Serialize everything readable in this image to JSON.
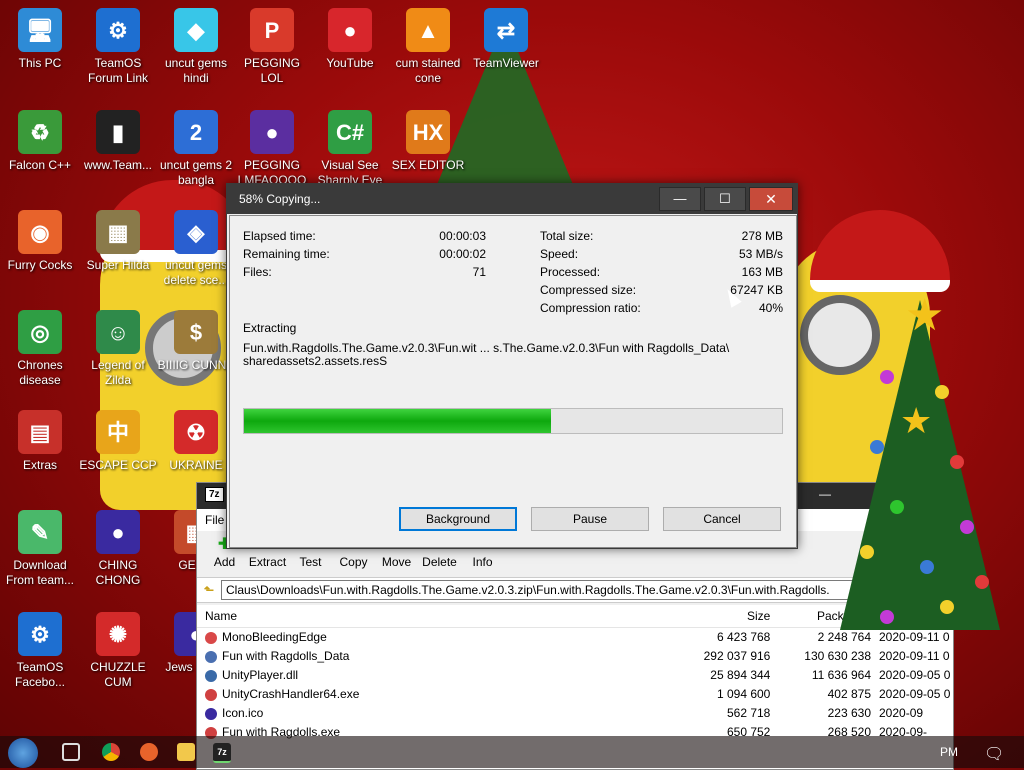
{
  "desktop_icons": [
    {
      "label": "This PC",
      "icon": "computer-icon",
      "color": "#2e8bd6"
    },
    {
      "label": "TeamOS Forum Link",
      "icon": "gear-icon",
      "color": "#1e6fd1"
    },
    {
      "label": "uncut gems hindi",
      "icon": "diamond-icon",
      "color": "#38c6e8"
    },
    {
      "label": "PEGGING LOL",
      "icon": "pegging-icon",
      "color": "#d93a2b"
    },
    {
      "label": "YouTube",
      "icon": "angry-bird-icon",
      "color": "#d8262c"
    },
    {
      "label": "cum stained cone",
      "icon": "vlc-cone-icon",
      "color": "#f08b16"
    },
    {
      "label": "TeamViewer",
      "icon": "teamviewer-icon",
      "color": "#1e7ad6"
    },
    {
      "label": "Falcon C++",
      "icon": "falcon-icon",
      "color": "#3a9a3a"
    },
    {
      "label": "www.Team...",
      "icon": "book-icon",
      "color": "#222222"
    },
    {
      "label": "uncut gems 2 bangla",
      "icon": "gems-icon",
      "color": "#2d6ed6"
    },
    {
      "label": "PEGGING LMFAOOOO",
      "icon": "pegging-ball-icon",
      "color": "#5b2ea0"
    },
    {
      "label": "Visual See Sharply Eye",
      "icon": "csharp-icon",
      "color": "#2f9e44"
    },
    {
      "label": "SEX EDITOR",
      "icon": "hex-editor-icon",
      "color": "#e07a1a"
    },
    {
      "label": "Furry Cocks",
      "icon": "firefox-icon",
      "color": "#e8632b"
    },
    {
      "label": "Super Hilda",
      "icon": "game-icon",
      "color": "#8a7a4a"
    },
    {
      "label": "uncut gems delete sce...",
      "icon": "gem-ring-icon",
      "color": "#2a5fd0"
    },
    {
      "label": "Chrones disease",
      "icon": "chrome-icon",
      "color": "#2f9e44"
    },
    {
      "label": "Legend of Zilda",
      "icon": "zelda-icon",
      "color": "#2f8a4a"
    },
    {
      "label": "BIIIIG CUNNY",
      "icon": "money-bag-icon",
      "color": "#9c7b3a"
    },
    {
      "label": "Extras",
      "icon": "folder-icon",
      "color": "#c7302a"
    },
    {
      "label": "ESCAPE CCP",
      "icon": "mahjong-icon",
      "color": "#e8a51a"
    },
    {
      "label": "UKRAINE",
      "icon": "radiation-icon",
      "color": "#d42a2a"
    },
    {
      "label": "Download From team...",
      "icon": "notepad-icon",
      "color": "#4ab86a"
    },
    {
      "label": "CHING CHONG",
      "icon": "ball-icon",
      "color": "#3a2aa0"
    },
    {
      "label": "GENO",
      "icon": "game-icon",
      "color": "#c44a2a"
    },
    {
      "label": "TeamOS Facebo...",
      "icon": "gear-icon",
      "color": "#1e6fd1"
    },
    {
      "label": "CHUZZLE CUM",
      "icon": "chuzzle-icon",
      "color": "#d42a2a"
    },
    {
      "label": "Jews I Pale",
      "icon": "ball-icon",
      "color": "#3a2aa0"
    }
  ],
  "zip_window": {
    "app_badge": "7z",
    "menu": "File",
    "toolbar": [
      {
        "label": "Add",
        "icon": "plus-icon"
      },
      {
        "label": "Extract",
        "icon": "minus-icon"
      },
      {
        "label": "Test",
        "icon": "check-icon"
      },
      {
        "label": "Copy",
        "icon": "copy-arrow-icon"
      },
      {
        "label": "Move",
        "icon": "move-arrow-icon"
      },
      {
        "label": "Delete",
        "icon": "delete-x-icon"
      },
      {
        "label": "Info",
        "icon": "info-icon"
      }
    ],
    "address": "Claus\\Downloads\\Fun.with.Ragdolls.The.Game.v2.0.3.zip\\Fun.with.Ragdolls.The.Game.v2.0.3\\Fun.with.Ragdolls.",
    "columns": {
      "name": "Name",
      "size": "Size",
      "packed": "Packed Si",
      "modified": "Modifie"
    },
    "files": [
      {
        "name": "MonoBleedingEdge",
        "size": "6 423 768",
        "packed": "2 248 764",
        "modified": "2020-09-11 0",
        "color": "#d94848"
      },
      {
        "name": "Fun with Ragdolls_Data",
        "size": "292 037 916",
        "packed": "130 630 238",
        "modified": "2020-09-11 0",
        "color": "#4a6fb0"
      },
      {
        "name": "UnityPlayer.dll",
        "size": "25 894 344",
        "packed": "11 636 964",
        "modified": "2020-09-05 0",
        "color": "#3a6aa8"
      },
      {
        "name": "UnityCrashHandler64.exe",
        "size": "1 094 600",
        "packed": "402 875",
        "modified": "2020-09-05 0",
        "color": "#d04040"
      },
      {
        "name": "Icon.ico",
        "size": "562 718",
        "packed": "223 630",
        "modified": "2020-09",
        "color": "#3a2aa0"
      },
      {
        "name": "Fun with Ragdolls.exe",
        "size": "650 752",
        "packed": "268 520",
        "modified": "2020-09-",
        "color": "#d04040"
      }
    ]
  },
  "dialog": {
    "title": "58% Copying...",
    "progress_fraction": 0.57,
    "left_stats": [
      {
        "label": "Elapsed time:",
        "value": "00:00:03"
      },
      {
        "label": "Remaining time:",
        "value": "00:00:02"
      },
      {
        "label": "Files:",
        "value": "71"
      }
    ],
    "right_stats": [
      {
        "label": "Total size:",
        "value": "278 MB"
      },
      {
        "label": "Speed:",
        "value": "53 MB/s"
      },
      {
        "label": "Processed:",
        "value": "163 MB"
      },
      {
        "label": "Compressed size:",
        "value": "67247 KB"
      },
      {
        "label": "Compression ratio:",
        "value": "40%"
      }
    ],
    "operation": "Extracting",
    "path_line1": "Fun.with.Ragdolls.The.Game.v2.0.3\\Fun.wit ... s.The.Game.v2.0.3\\Fun with Ragdolls_Data\\",
    "path_line2": "sharedassets2.assets.resS",
    "buttons": {
      "background": "Background",
      "pause": "Pause",
      "cancel": "Cancel"
    }
  },
  "taskbar": {
    "clock": "PM"
  }
}
